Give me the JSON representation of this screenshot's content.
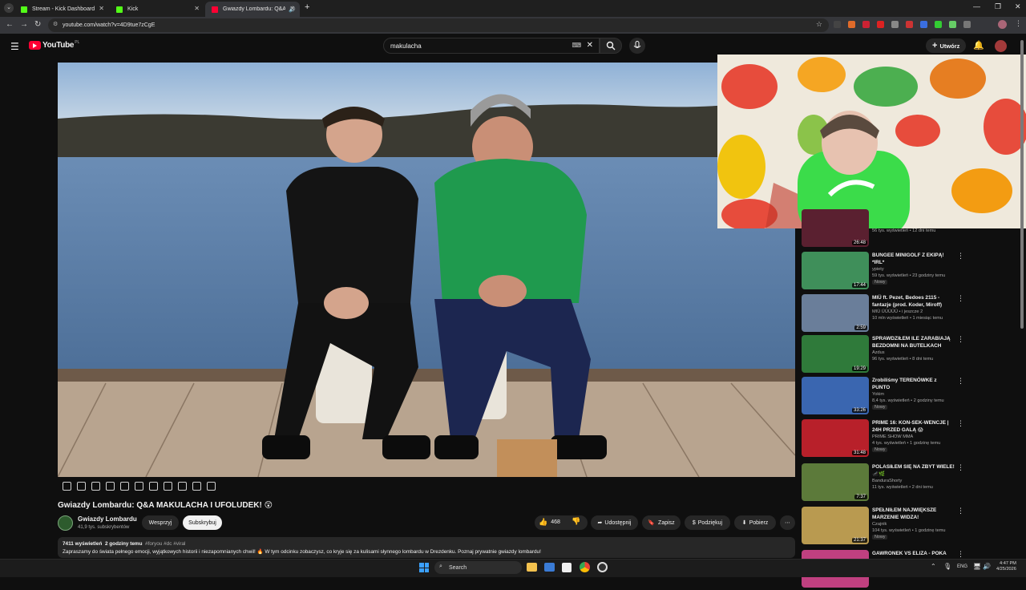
{
  "browser": {
    "tabs": [
      {
        "label": "Stream - Kick Dashboard",
        "active": false,
        "favicon_color": "#53fc18"
      },
      {
        "label": "Kick",
        "active": false,
        "favicon_color": "#53fc18"
      },
      {
        "label": "Gwiazdy Lombardu: Q&A M",
        "active": true,
        "favicon_color": "#ff0033"
      }
    ],
    "url": "youtube.com/watch?v=4D9tue7zCgE"
  },
  "youtube": {
    "logo": "YouTube",
    "logo_region": "PL",
    "search_value": "makulacha",
    "create_label": "Utwórz"
  },
  "video": {
    "title": "Gwiazdy Lombardu: Q&A MAKULACHA I UFOLUDEK! 😲",
    "channel": "Gwiazdy Lombardu",
    "subscribers": "41,9 tys. subskrybentów",
    "support_label": "Wesprzyj",
    "subscribe_label": "Subskrybuj",
    "likes": "468",
    "share_label": "Udostępnij",
    "save_label": "Zapisz",
    "thanks_label": "Podziękuj",
    "download_label": "Pobierz",
    "views": "7411 wyświetleń",
    "age": "2 godziny temu",
    "hashtags": "#foryou #dc #viral",
    "description": "Zapraszamy do świata pełnego emocji, wyjątkowych historii i niezapomnianych chwil! 🔥 W tym odcinku zobaczysz, co kryje się za kulisami słynnego lombardu w Drezdenku. Poznaj prywatnie gwiazdy lombardu!"
  },
  "recommendations": [
    {
      "title": "",
      "channel": "",
      "meta": "56 tys. wyświetleń • 12 dni temu",
      "duration": "26:48",
      "badge": "",
      "thumb": "#5a2030"
    },
    {
      "title": "BUNGEE MINIGOLF Z EKIPĄ! *IRL*",
      "channel": "ypiety",
      "meta": "59 tys. wyświetleń • 23 godziny temu",
      "duration": "17:44",
      "badge": "Nowy",
      "thumb": "#3f8f5a"
    },
    {
      "title": "MIÜ ft. Pezet, Bedoes 2115 - fantazje (prod. Koder, Miroff)",
      "channel": "MIÜ ÜÜÜÜÜ • i jeszcze 2",
      "meta": "10 mln wyświetleń • 1 miesiąc temu",
      "duration": "2:59",
      "badge": "",
      "thumb": "#6a7e9a"
    },
    {
      "title": "SPRAWDZIŁEM ILE ZARABIAJĄ BEZDOMNI NA BUTELKACH",
      "channel": "Azdus",
      "meta": "96 tys. wyświetleń • 8 dni temu",
      "duration": "19:29",
      "badge": "",
      "thumb": "#2f7a3a"
    },
    {
      "title": "Zrobiliśmy TERENÓWKE z PUNTO",
      "channel": "Yokim",
      "meta": "8,4 tys. wyświetleń • 2 godziny temu",
      "duration": "33:26",
      "badge": "Nowy",
      "thumb": "#3a66b0"
    },
    {
      "title": "PRIME 16: KON-SEK-WENCJE | 24H PRZED GALĄ 😱",
      "channel": "PRIME SHOW MMA",
      "meta": "4 tys. wyświetleń • 1 godzinę temu",
      "duration": "31:48",
      "badge": "Nowy",
      "thumb": "#b8202a"
    },
    {
      "title": "POLASIŁEM SIĘ NA ZBYT WIELE! 🦟🌿",
      "channel": "BandurаShorty",
      "meta": "11 tys. wyświetleń • 2 dni temu",
      "duration": "7:37",
      "badge": "",
      "thumb": "#5c7a3a"
    },
    {
      "title": "SPEŁNIŁEM NAJWIĘKSZE MARZENIE WIDZA!",
      "channel": "Czajnik",
      "meta": "104 tys. wyświetleń • 1 godzinę temu",
      "duration": "21:37",
      "badge": "Nowy",
      "thumb": "#b99a50"
    },
    {
      "title": "GAWRONEK VS ELIZA - POKA",
      "channel": "",
      "meta": "",
      "duration": "",
      "badge": "",
      "thumb": "#c04080"
    }
  ],
  "taskbar": {
    "search_label": "Search",
    "lang": "ENG",
    "time": "4:47 PM",
    "date": "4/25/2026"
  }
}
